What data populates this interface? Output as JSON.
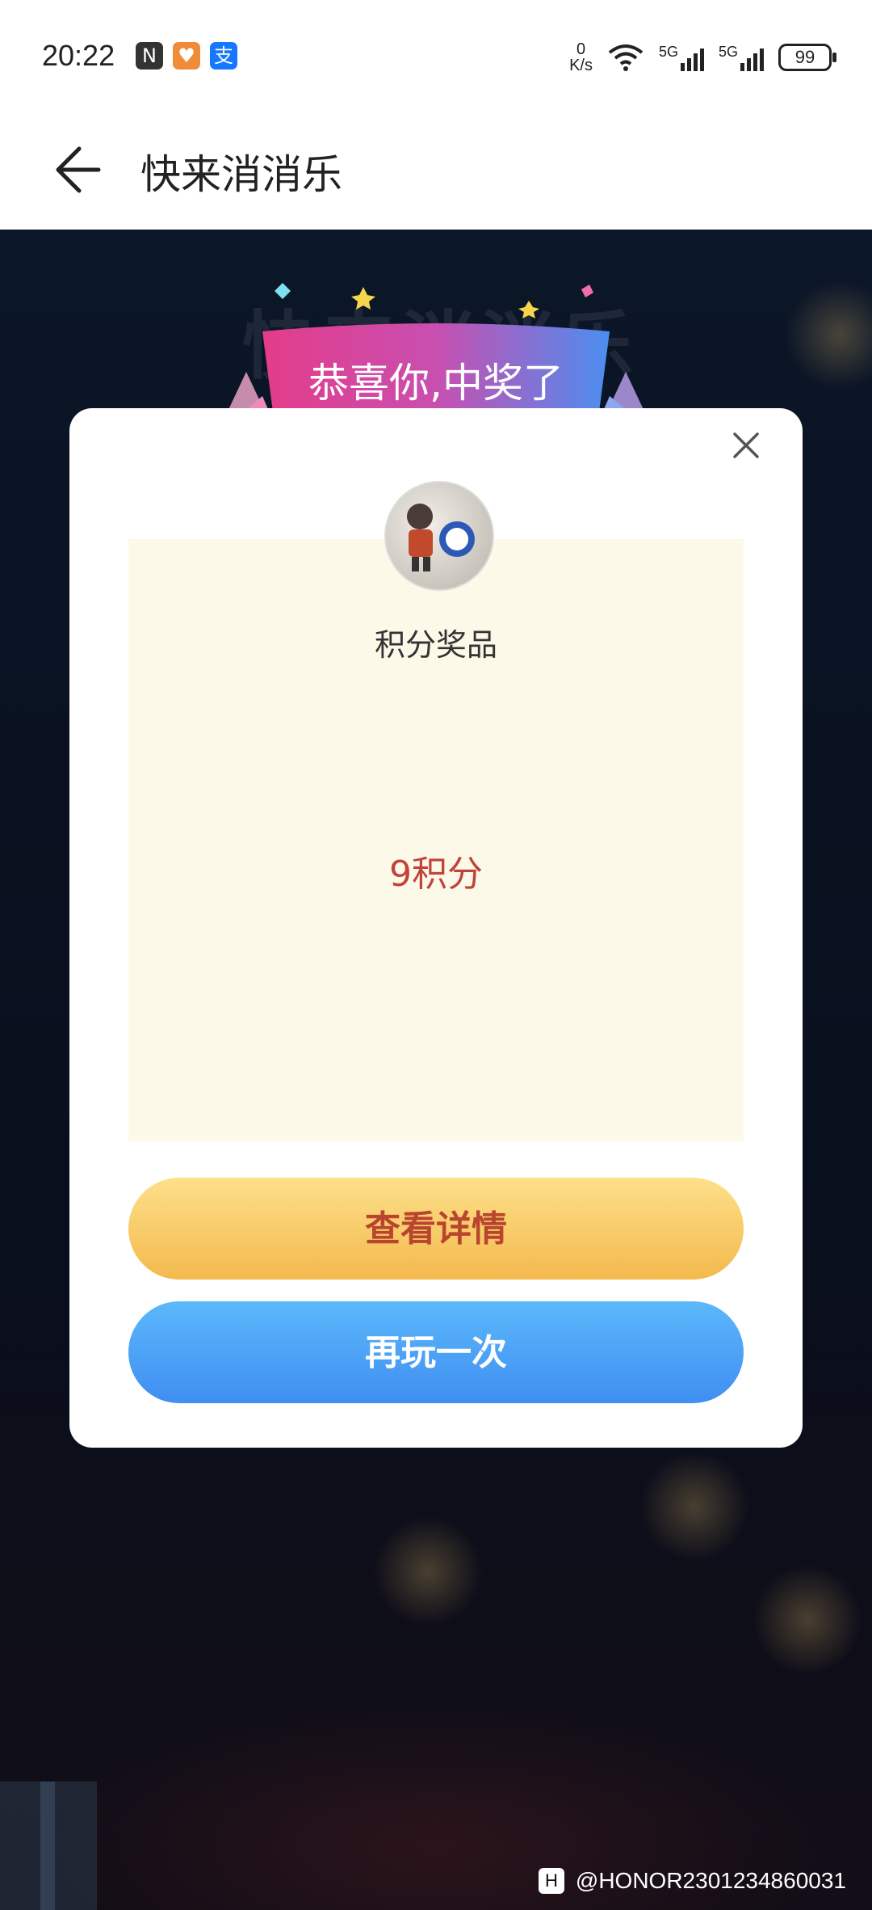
{
  "status_bar": {
    "time": "20:22",
    "net_speed_value": "0",
    "net_speed_unit": "K/s",
    "battery": "99",
    "network_labels": [
      "5G",
      "5G"
    ],
    "icons": [
      "nfc-icon",
      "huawei-health-icon",
      "alipay-icon",
      "wifi-icon",
      "signal-icon",
      "battery-icon"
    ]
  },
  "app_bar": {
    "title": "快来消消乐"
  },
  "background": {
    "title": "快来消消乐"
  },
  "modal": {
    "ribbon_text": "恭喜你,中奖了",
    "prize_name": "积分奖品",
    "prize_value": "9积分",
    "detail_button": "查看详情",
    "again_button": "再玩一次"
  },
  "watermark": {
    "text": "@HONOR2301234860031"
  },
  "colors": {
    "detail_button": "#f3b94d",
    "again_button": "#3f8ef2",
    "prize_value": "#c0433b",
    "prize_area_bg": "#fdf9e9"
  }
}
